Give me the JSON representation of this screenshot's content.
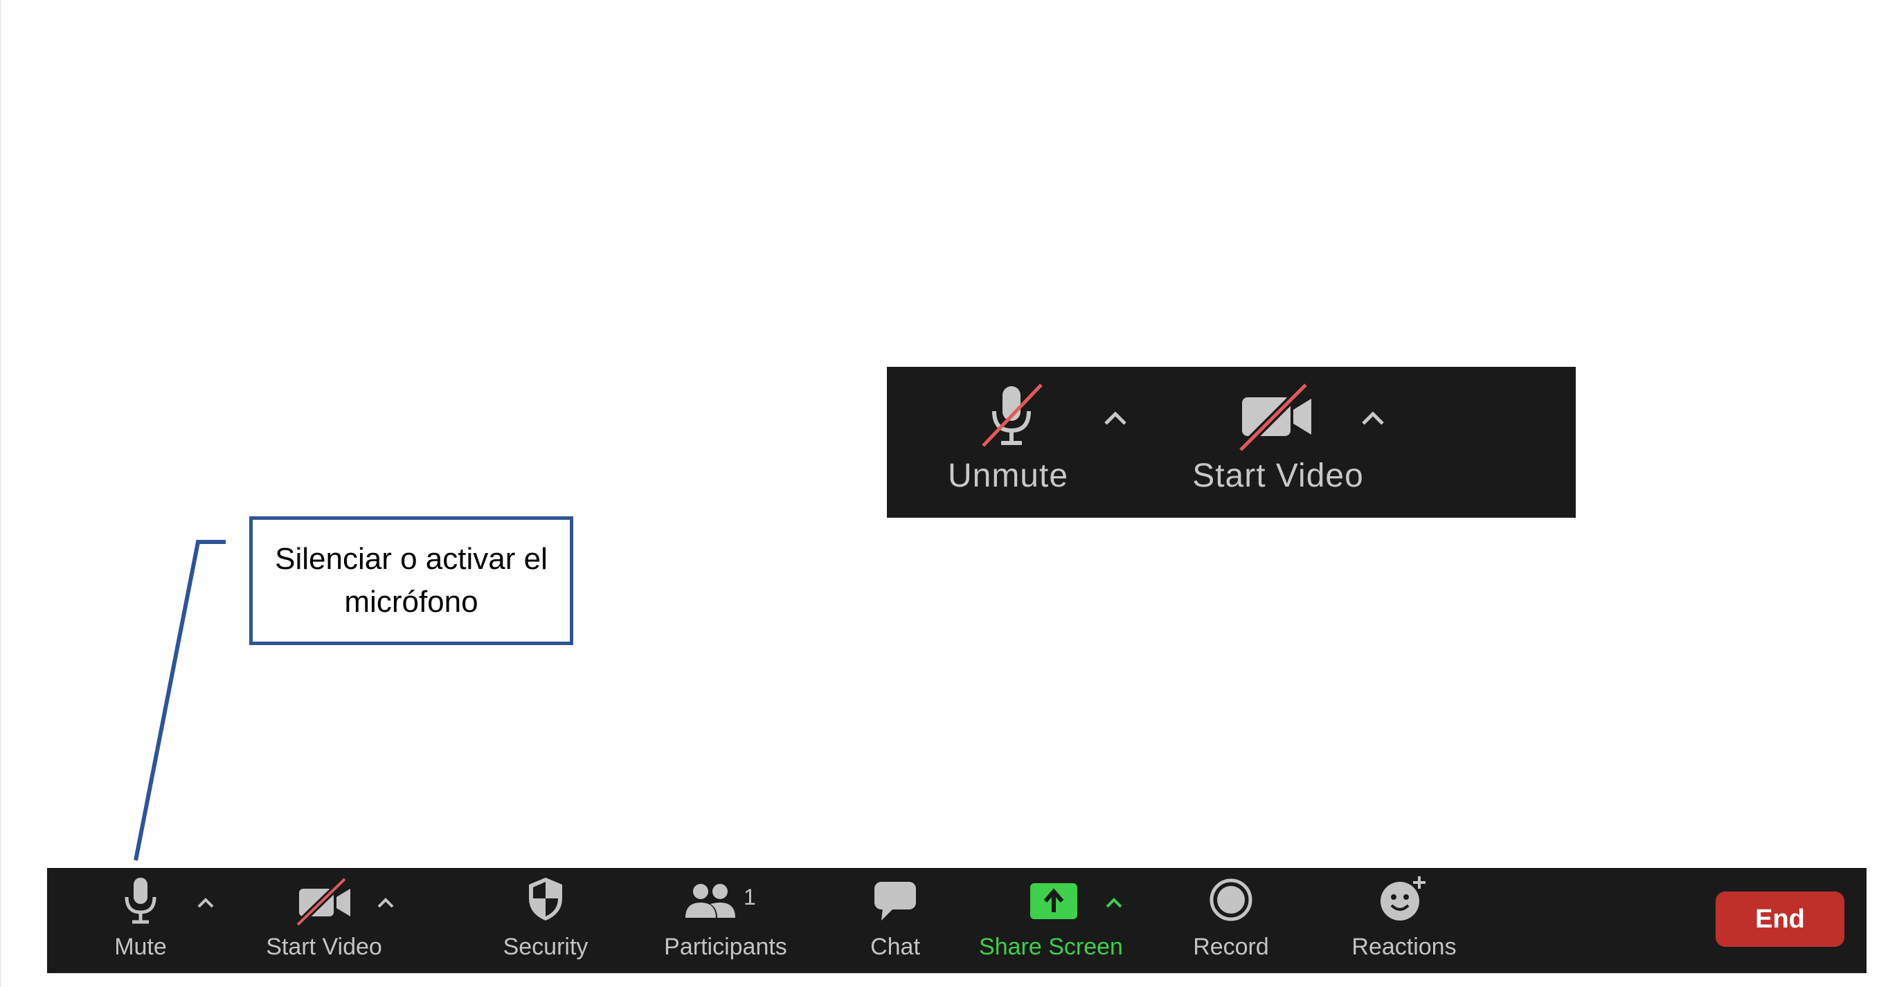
{
  "inset": {
    "unmute_label": "Unmute",
    "start_video_label": "Start Video"
  },
  "callout": {
    "line1": "Silenciar o activar el",
    "line2": "micrófono"
  },
  "toolbar": {
    "mute_label": "Mute",
    "start_video_label": "Start Video",
    "security_label": "Security",
    "participants_label": "Participants",
    "participants_count": "1",
    "chat_label": "Chat",
    "share_screen_label": "Share Screen",
    "record_label": "Record",
    "reactions_label": "Reactions",
    "end_label": "End"
  },
  "colors": {
    "toolbar_bg": "#1a1a1a",
    "icon_gray": "#c4c4c4",
    "muted_slash": "#e05a5a",
    "share_green": "#3ecf4c",
    "end_red": "#c0302b",
    "callout_border": "#2f5496"
  },
  "icons": [
    "microphone-muted-icon",
    "video-camera-muted-icon",
    "microphone-icon",
    "shield-icon",
    "participants-icon",
    "chat-bubble-icon",
    "share-screen-icon",
    "record-icon",
    "reactions-icon",
    "caret-up-icon"
  ]
}
